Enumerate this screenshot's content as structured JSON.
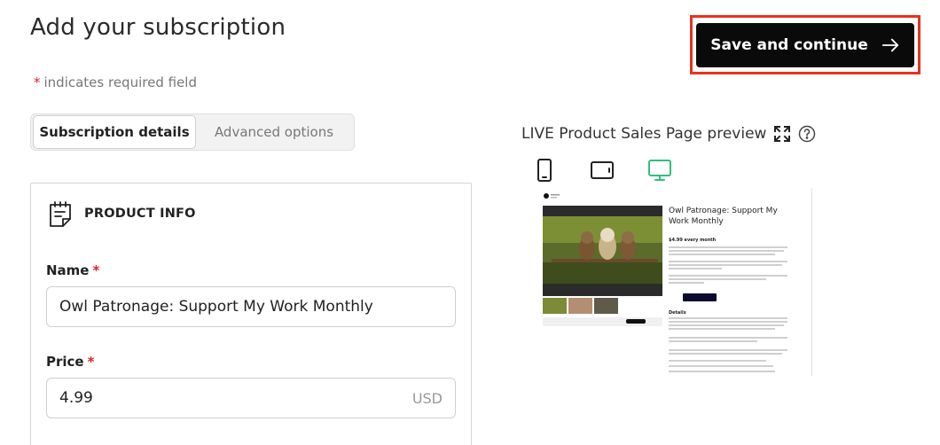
{
  "header": {
    "title": "Add your subscription",
    "save_label": "Save and continue"
  },
  "required_note": {
    "star": "*",
    "text": "indicates required field"
  },
  "tabs": [
    {
      "label": "Subscription details",
      "active": true
    },
    {
      "label": "Advanced options",
      "active": false
    }
  ],
  "product_info": {
    "heading": "PRODUCT INFO",
    "name_label": "Name",
    "name_value": "Owl Patronage: Support My Work Monthly",
    "price_label": "Price",
    "price_value": "4.99",
    "currency": "USD",
    "required_star": "*"
  },
  "preview": {
    "title": "LIVE Product Sales Page preview",
    "devices": [
      "phone-icon",
      "tablet-icon",
      "desktop-icon"
    ],
    "active_device": "desktop-icon",
    "product_title": "Owl Patronage: Support My Work Monthly",
    "price_text": "$4.99 every month",
    "details_heading": "Details"
  },
  "colors": {
    "accent": "#2fbf7a",
    "highlight": "#e8331c",
    "primary_button": "#0a0a0a",
    "required": "#e02020"
  }
}
